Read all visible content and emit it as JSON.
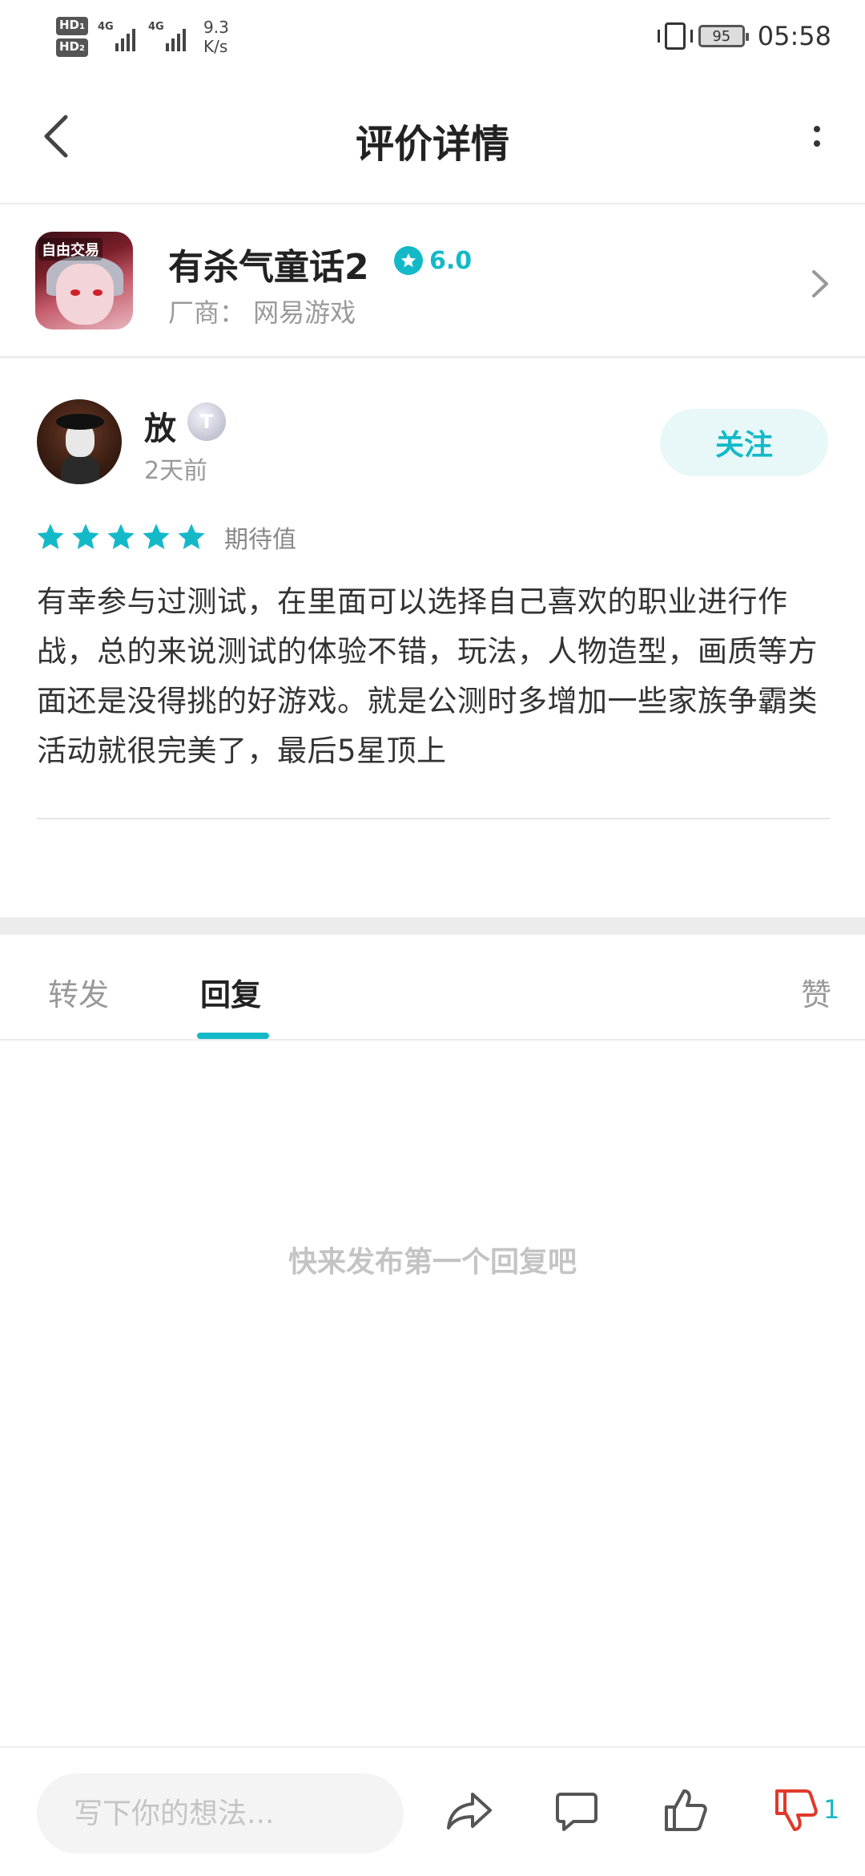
{
  "status_bar": {
    "hd1": "HD",
    "hd1_sub": "1",
    "hd2": "HD",
    "hd2_sub": "2",
    "network1": "4G",
    "network2": "4G",
    "speed_value": "9.3",
    "speed_unit": "K/s",
    "battery": "95",
    "time": "05:58"
  },
  "header": {
    "title": "评价详情"
  },
  "game": {
    "name": "有杀气童话2",
    "rating": "6.0",
    "vendor": "厂商：  网易游戏",
    "icon_banner": "自由交易"
  },
  "review": {
    "username": "放",
    "badge": "T",
    "time": "2天前",
    "follow_label": "关注",
    "stars": 5,
    "star_label": "期待值",
    "text": "有幸参与过测试，在里面可以选择自己喜欢的职业进行作战，总的来说测试的体验不错，玩法，人物造型，画质等方面还是没得挑的好游戏。就是公测时多增加一些家族争霸类活动就很完美了，最后5星顶上"
  },
  "tabs": {
    "items": [
      {
        "label": "转发",
        "active": false
      },
      {
        "label": "回复",
        "active": true
      },
      {
        "label": "赞",
        "active": false
      }
    ]
  },
  "replies": {
    "empty_text": "快来发布第一个回复吧"
  },
  "bottom_bar": {
    "input_placeholder": "写下你的想法...",
    "dislike_count": "1"
  },
  "colors": {
    "accent": "#14b9c8",
    "dislike": "#e0392b",
    "follow_bg": "#e8f8f9"
  }
}
